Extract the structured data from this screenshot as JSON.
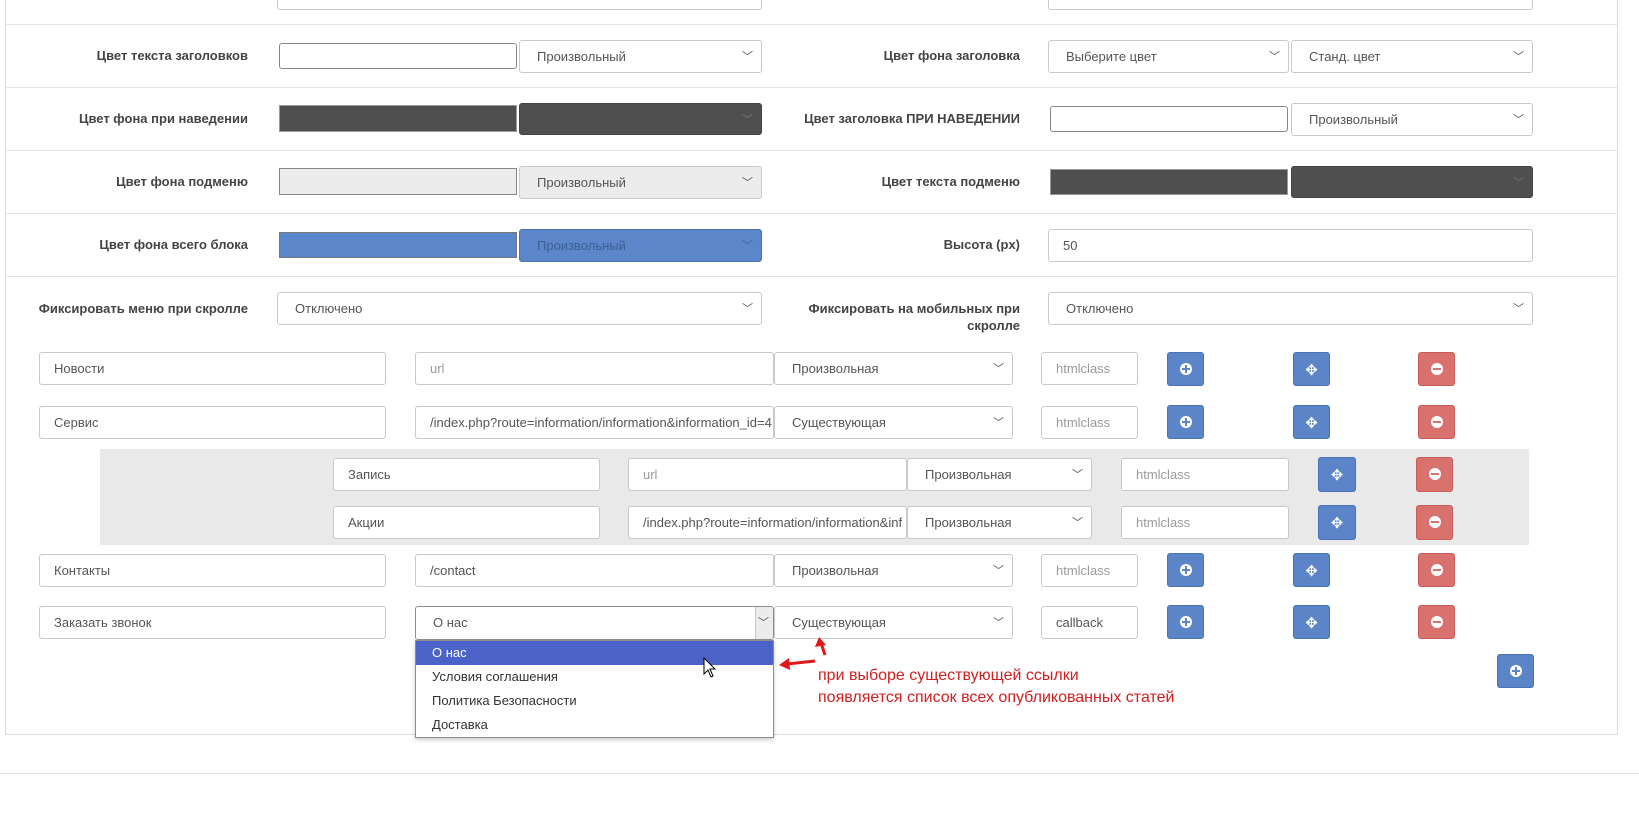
{
  "settings": {
    "header_text_color_label": "Цвет текста заголовков",
    "header_text_color_select": "Произвольный",
    "header_bg_color_label": "Цвет фона заголовка",
    "header_bg_color_select1": "Выберите цвет",
    "header_bg_color_select2": "Станд. цвет",
    "hover_bg_label": "Цвет фона при наведении",
    "hover_header_label": "Цвет заголовка ПРИ НАВЕДЕНИИ",
    "hover_header_select": "Произвольный",
    "submenu_bg_label": "Цвет фона подменю",
    "submenu_bg_select": "Произвольный",
    "submenu_text_label": "Цвет текста подменю",
    "block_bg_label": "Цвет фона всего блока",
    "block_bg_select": "Произвольный",
    "height_label": "Высота (px)",
    "height_value": "50",
    "fix_scroll_label": "Фиксировать меню при скролле",
    "fix_scroll_value": "Отключено",
    "fix_mobile_label": "Фиксировать на мобильных при скролле",
    "fix_mobile_value": "Отключено"
  },
  "colors": {
    "hover_bg": "#4f4f4f",
    "submenu_bg": "#ececec",
    "submenu_text": "#4f4f4f",
    "block_bg": "#5b86c9",
    "header_text": "#ffffff",
    "hover_header": "#ffffff"
  },
  "placeholders": {
    "url": "url",
    "htmlclass": "htmlclass"
  },
  "menu_items": [
    {
      "name": "Новости",
      "url": "",
      "type": "Произвольная",
      "htmlclass": ""
    },
    {
      "name": "Сервис",
      "url": "/index.php?route=information/information&information_id=4",
      "type": "Существующая",
      "htmlclass": ""
    }
  ],
  "sub_items": [
    {
      "name": "Запись",
      "url": "",
      "type": "Произвольная",
      "htmlclass": ""
    },
    {
      "name": "Акции",
      "url": "/index.php?route=information/information&inf",
      "type": "Произвольная",
      "htmlclass": ""
    }
  ],
  "menu_items2": [
    {
      "name": "Контакты",
      "url": "/contact",
      "type": "Произвольная",
      "htmlclass": ""
    },
    {
      "name": "Заказать звонок",
      "url": "О нас",
      "type": "Существующая",
      "htmlclass": "callback"
    }
  ],
  "dropdown": {
    "options": [
      "О нас",
      "Условия соглашения",
      "Политика Безопасности",
      "Доставка"
    ]
  },
  "annotation": {
    "line1": "при выборе существующей ссылки",
    "line2": "появляется список всех опубликованных статей"
  }
}
